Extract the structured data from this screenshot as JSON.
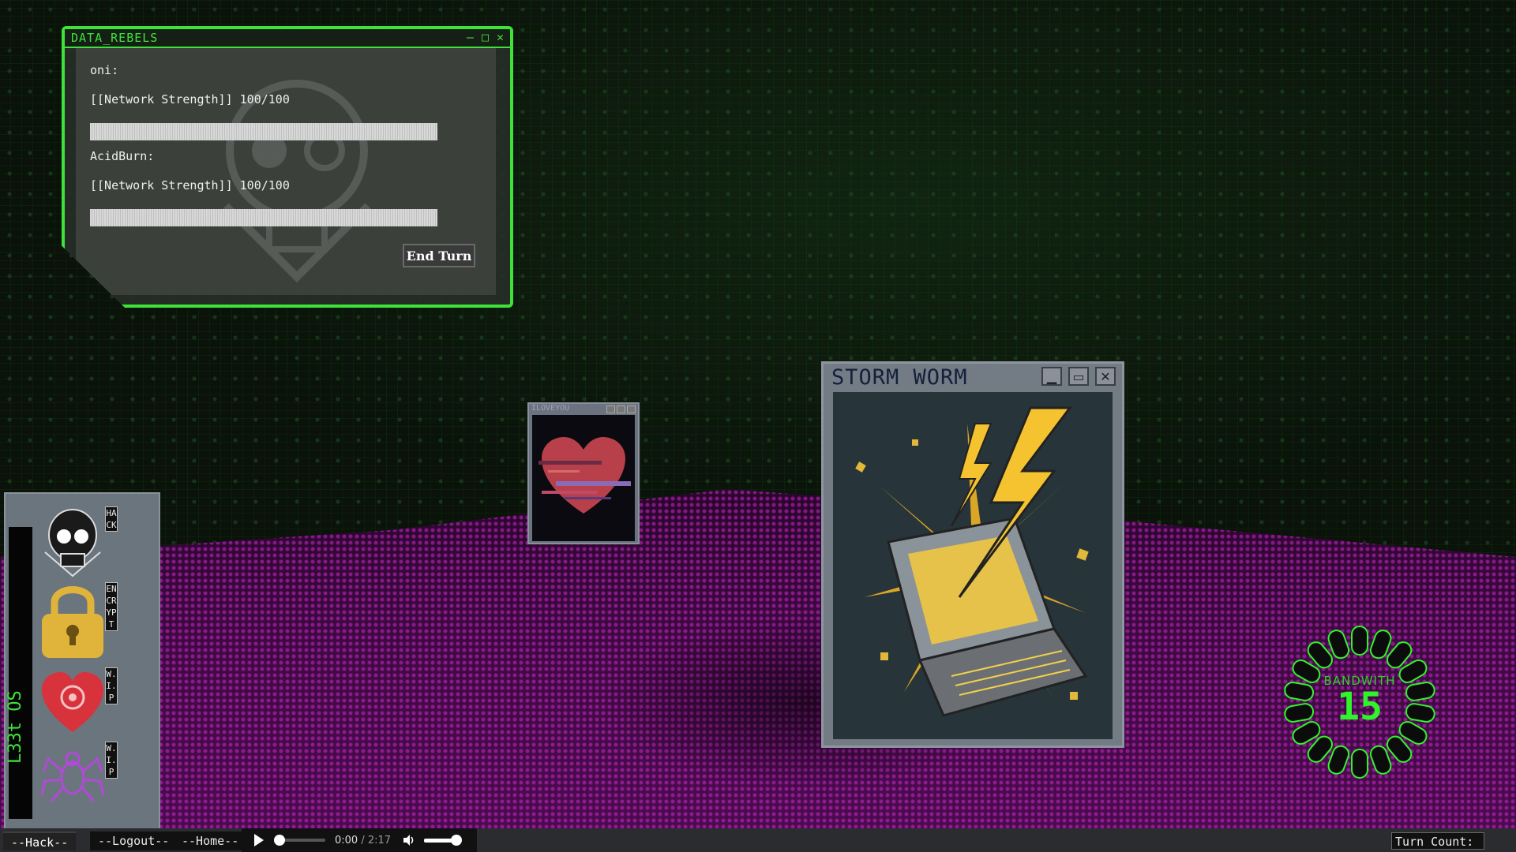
{
  "panel": {
    "title": "DATA_REBELS",
    "controls": {
      "minimize": "–",
      "maximize": "□",
      "close": "✕"
    },
    "players": [
      {
        "name": "oni:",
        "strength_text": "[[Network Strength]] 100/100",
        "strength_value": 100,
        "strength_max": 100
      },
      {
        "name": "AcidBurn:",
        "strength_text": "[[Network Strength]] 100/100",
        "strength_value": 100,
        "strength_max": 100
      }
    ],
    "end_turn_label": "End Turn"
  },
  "cards": {
    "iloveyou": {
      "title": "ILOVEYOU",
      "art_icon": "glitched-heart-icon"
    },
    "storm_worm": {
      "title": "STORM WORM",
      "art_icon": "exploding-laptop-lightning-icon"
    }
  },
  "dock": {
    "os_label": "L33t OS",
    "items": [
      {
        "label": "HACK",
        "icon": "skull-icon"
      },
      {
        "label": "ENCRYPT",
        "icon": "padlock-icon"
      },
      {
        "label": "W.I.P",
        "icon": "heart-eye-icon"
      },
      {
        "label": "W.I.P",
        "icon": "spider-icon"
      }
    ]
  },
  "bandwidth": {
    "label": "BANDWITH",
    "value": "15"
  },
  "bottom": {
    "nav": [
      "--Hack--",
      "--Logout--",
      "--Home--"
    ],
    "audio": {
      "current": "0:00",
      "separator": " / ",
      "total": "2:17"
    },
    "turn_count_label": "Turn Count:",
    "turn_count_value": ""
  },
  "colors": {
    "accent": "#3ee23a",
    "floor": "#4b0b4e",
    "card_frame": "#737b85"
  }
}
